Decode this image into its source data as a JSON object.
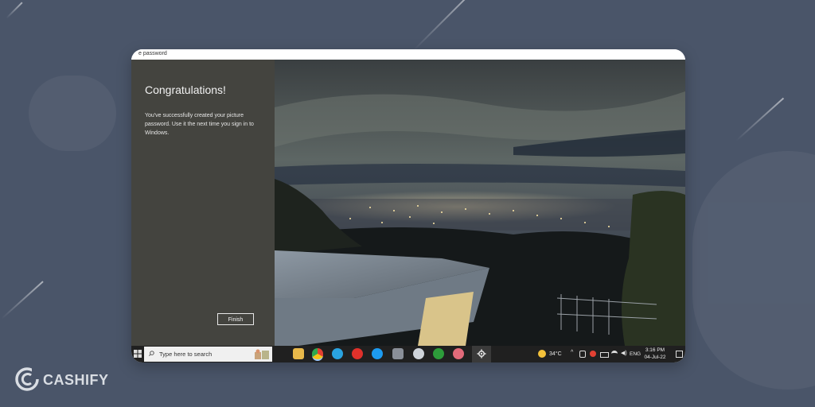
{
  "window": {
    "title": "e password"
  },
  "dialog": {
    "heading": "Congratulations!",
    "message": "You've successfully created your picture password. Use it the next time you sign in to Windows.",
    "finish_label": "Finish"
  },
  "taskbar": {
    "search_placeholder": "Type here to search",
    "apps": [
      "file-explorer-icon",
      "chrome-icon",
      "telegram-icon",
      "youtube-icon",
      "twitter-icon",
      "camera-icon",
      "cloud-icon",
      "xbox-icon",
      "snipping-tool-icon",
      "settings-icon"
    ],
    "weather": "34°C",
    "language": "ENG",
    "time": "3:16 PM",
    "date": "04-Jul-22"
  },
  "branding": {
    "logo_text": "CASHIFY"
  },
  "colors": {
    "background": "#4a5569",
    "panel": "#44443f",
    "taskbar": "#202020",
    "accent": "#9ecbff"
  }
}
